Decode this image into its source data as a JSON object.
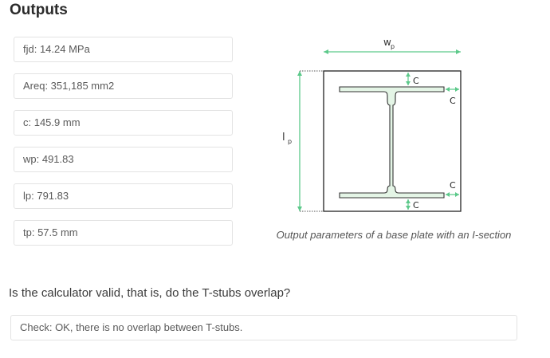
{
  "outputs": {
    "title": "Outputs",
    "fields": [
      {
        "text": "fjd: 14.24 MPa"
      },
      {
        "text": "Areq: 351,185 mm2"
      },
      {
        "text": "c: 145.9 mm"
      },
      {
        "text": "wp: 491.83"
      },
      {
        "text": "lp: 791.83"
      },
      {
        "text": "tp: 57.5 mm"
      }
    ]
  },
  "diagram": {
    "label_wp": "w",
    "label_wp_sub": "p",
    "label_lp": "l",
    "label_lp_sub": "p",
    "label_c": "C",
    "caption": "Output parameters of a base plate with an I-section",
    "accent_color": "#5cc98a"
  },
  "validity": {
    "question": "Is the calculator valid, that is, do the T-stubs overlap?",
    "check_text": "Check: OK, there is no overlap between T-stubs."
  }
}
